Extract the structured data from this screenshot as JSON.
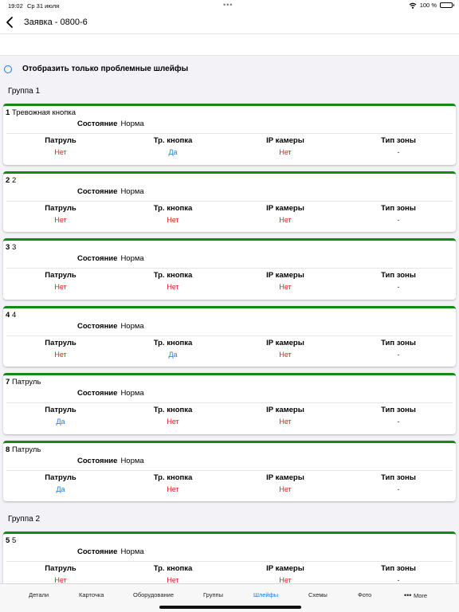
{
  "status_bar": {
    "time": "19:02",
    "date": "Ср 31 июля",
    "battery": "100 %"
  },
  "nav": {
    "title": "Заявка - 0800-6"
  },
  "filter": {
    "label": "Отобразить только проблемные шлейфы"
  },
  "labels": {
    "state": "Состояние",
    "col_patrol": "Патруль",
    "col_button": "Тр. кнопка",
    "col_ip": "IP камеры",
    "col_zone": "Тип зоны"
  },
  "groups": [
    {
      "title": "Группа 1",
      "loops": [
        {
          "num": "1",
          "name": "Тревожная кнопка",
          "state": "Норма",
          "patrol": "Нет",
          "button": "Да",
          "ip": "Нет",
          "zone": "-"
        },
        {
          "num": "2",
          "name": "2",
          "state": "Норма",
          "patrol": "Нет",
          "button": "Нет",
          "ip": "Нет",
          "zone": "-"
        },
        {
          "num": "3",
          "name": "3",
          "state": "Норма",
          "patrol": "Нет",
          "button": "Нет",
          "ip": "Нет",
          "zone": "-"
        },
        {
          "num": "4",
          "name": "4",
          "state": "Норма",
          "patrol": "Нет",
          "button": "Да",
          "ip": "Нет",
          "zone": "-"
        },
        {
          "num": "7",
          "name": "Патруль",
          "state": "Норма",
          "patrol": "Да",
          "button": "Нет",
          "ip": "Нет",
          "zone": "-"
        },
        {
          "num": "8",
          "name": "Патруль",
          "state": "Норма",
          "patrol": "Да",
          "button": "Нет",
          "ip": "Нет",
          "zone": "-"
        }
      ]
    },
    {
      "title": "Группа 2",
      "loops": [
        {
          "num": "5",
          "name": "5",
          "state": "Норма",
          "patrol": "Нет",
          "button": "Нет",
          "ip": "Нет",
          "zone": "-"
        }
      ]
    }
  ],
  "tabs": [
    {
      "label": "Детали",
      "active": false
    },
    {
      "label": "Карточка",
      "active": false
    },
    {
      "label": "Оборудование",
      "active": false
    },
    {
      "label": "Группы",
      "active": false
    },
    {
      "label": "Шлейфы",
      "active": true
    },
    {
      "label": "Схемы",
      "active": false
    },
    {
      "label": "Фото",
      "active": false
    },
    {
      "label": "More",
      "active": false
    }
  ],
  "colors": {
    "accent": "#1f7ae0",
    "status_ok": "#148a14",
    "no_value": "#e0191e",
    "yes_value": "#1f7ae0"
  }
}
